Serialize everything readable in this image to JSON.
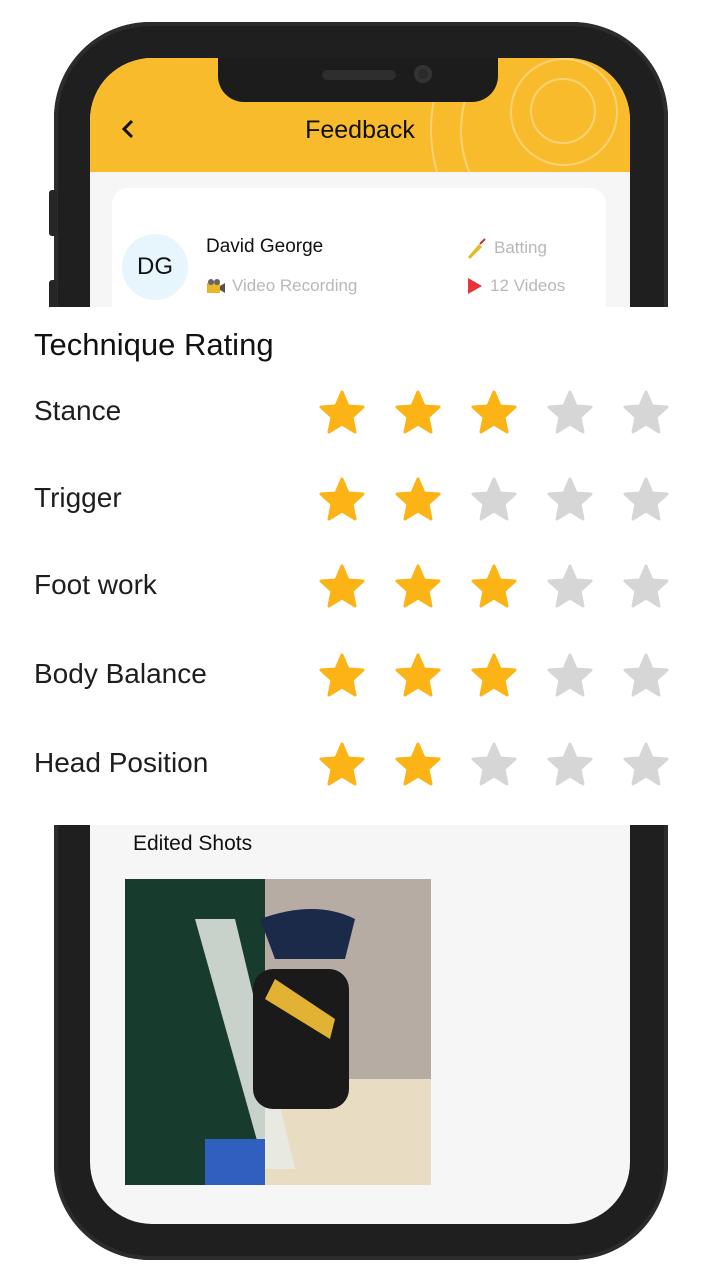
{
  "header": {
    "title": "Feedback",
    "back_icon": "chevron-left-icon",
    "color": "#f8bb2c"
  },
  "profile": {
    "initials": "DG",
    "name": "David George",
    "recording_type": "Video Recording",
    "recording_icon": "video-camera-icon",
    "skill": "Batting",
    "skill_icon": "cricket-bat-icon",
    "videos": "12 Videos",
    "videos_icon": "play-icon"
  },
  "technique_rating": {
    "title": "Technique Rating",
    "max_stars": 5,
    "filled_color": "#fbb316",
    "empty_color": "#d6d6d6",
    "items": [
      {
        "label": "Stance",
        "rating": 3
      },
      {
        "label": "Trigger",
        "rating": 2
      },
      {
        "label": "Foot work",
        "rating": 3
      },
      {
        "label": "Body Balance",
        "rating": 3
      },
      {
        "label": "Head Position",
        "rating": 2
      }
    ]
  },
  "edited_shots": {
    "title": "Edited Shots",
    "items": [
      {
        "description": "Batsman in helmet and black-yellow jersey playing a shot in practice nets"
      }
    ]
  }
}
